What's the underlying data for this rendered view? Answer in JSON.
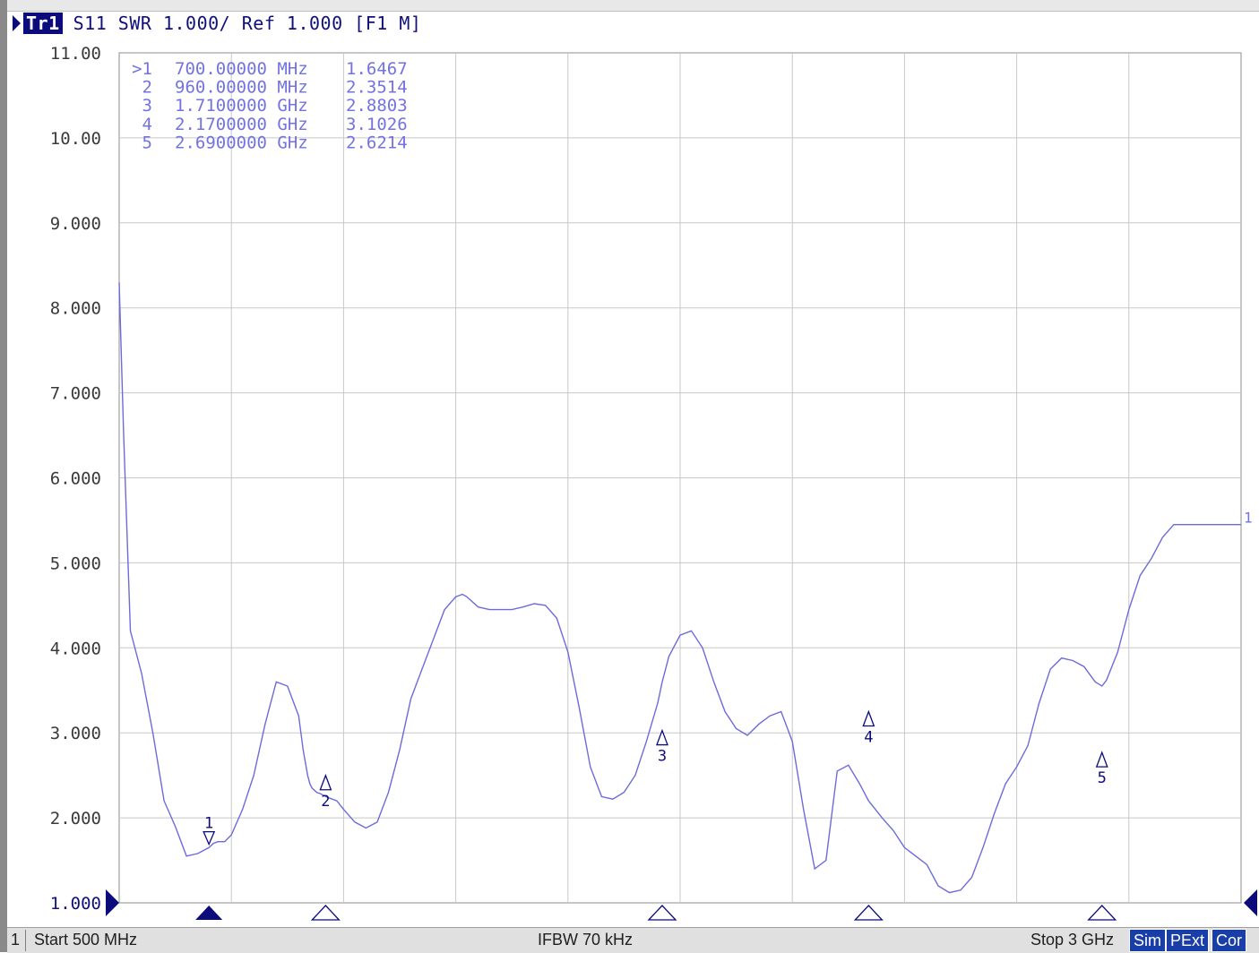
{
  "header": {
    "trace_badge": "Tr1",
    "measurement": "S11 SWR 1.000/ Ref 1.000 [F1 M]"
  },
  "marker_table": [
    {
      "id": ">1",
      "freq": "700.00000 MHz",
      "value": "1.6467"
    },
    {
      "id": "2",
      "freq": "960.00000 MHz",
      "value": "2.3514"
    },
    {
      "id": "3",
      "freq": "1.7100000 GHz",
      "value": "2.8803"
    },
    {
      "id": "4",
      "freq": "2.1700000 GHz",
      "value": "3.1026"
    },
    {
      "id": "5",
      "freq": "2.6900000 GHz",
      "value": "2.6214"
    }
  ],
  "status": {
    "channel": "1",
    "start": "Start 500 MHz",
    "ifbw": "IFBW 70 kHz",
    "stop": "Stop 3 GHz",
    "badges": [
      "Sim",
      "PExt",
      "Cor"
    ]
  },
  "colors": {
    "trace": "#6b6bdc",
    "grid": "#c8c8c8",
    "marker_active": "#0b0b7c",
    "axis_text": "#3a3a3a",
    "marker_text": "#7373e0"
  },
  "chart_data": {
    "type": "line",
    "xlabel": "",
    "ylabel": "",
    "x_unit": "GHz",
    "xlim": [
      0.5,
      3.0
    ],
    "ylim": [
      1.0,
      11.0
    ],
    "y_ticks": [
      "11.00",
      "10.00",
      "9.000",
      "8.000",
      "7.000",
      "6.000",
      "5.000",
      "4.000",
      "3.000",
      "2.000",
      "1.000"
    ],
    "grid": true,
    "trace_end_label": "1",
    "series": [
      {
        "x": [
          0.5,
          0.51,
          0.525,
          0.55,
          0.575,
          0.6,
          0.625,
          0.65,
          0.675,
          0.7,
          0.71,
          0.72,
          0.735,
          0.75,
          0.775,
          0.8,
          0.825,
          0.85,
          0.875,
          0.9,
          0.91,
          0.92,
          0.925,
          0.93,
          0.94,
          0.95,
          0.96,
          0.97,
          0.985,
          1.0,
          1.025,
          1.05,
          1.075,
          1.1,
          1.125,
          1.15,
          1.175,
          1.2,
          1.225,
          1.25,
          1.265,
          1.275,
          1.3,
          1.325,
          1.35,
          1.375,
          1.4,
          1.425,
          1.45,
          1.475,
          1.5,
          1.525,
          1.55,
          1.575,
          1.6,
          1.625,
          1.65,
          1.675,
          1.7,
          1.71,
          1.725,
          1.75,
          1.775,
          1.8,
          1.825,
          1.85,
          1.875,
          1.9,
          1.925,
          1.95,
          1.975,
          2.0,
          2.025,
          2.05,
          2.075,
          2.1,
          2.125,
          2.15,
          2.17,
          2.2,
          2.225,
          2.25,
          2.275,
          2.3,
          2.31,
          2.325,
          2.35,
          2.375,
          2.4,
          2.425,
          2.45,
          2.475,
          2.5,
          2.525,
          2.55,
          2.575,
          2.6,
          2.625,
          2.65,
          2.675,
          2.69,
          2.7,
          2.725,
          2.75,
          2.775,
          2.8,
          2.825,
          2.85,
          2.875,
          2.9,
          2.925,
          2.95,
          2.975,
          3.0
        ],
        "values": [
          8.3,
          6.5,
          4.2,
          3.7,
          3.0,
          2.2,
          1.9,
          1.55,
          1.58,
          1.65,
          1.7,
          1.72,
          1.72,
          1.8,
          2.1,
          2.5,
          3.1,
          3.6,
          3.55,
          3.2,
          2.8,
          2.5,
          2.4,
          2.35,
          2.3,
          2.28,
          2.25,
          2.23,
          2.2,
          2.1,
          1.95,
          1.88,
          1.95,
          2.3,
          2.8,
          3.4,
          3.75,
          4.1,
          4.45,
          4.6,
          4.63,
          4.6,
          4.48,
          4.45,
          4.45,
          4.45,
          4.48,
          4.52,
          4.5,
          4.35,
          3.95,
          3.3,
          2.6,
          2.25,
          2.22,
          2.3,
          2.5,
          2.9,
          3.35,
          3.6,
          3.9,
          4.15,
          4.2,
          4.0,
          3.6,
          3.25,
          3.05,
          2.97,
          3.1,
          3.2,
          3.25,
          2.9,
          2.1,
          1.4,
          1.5,
          2.55,
          2.62,
          2.4,
          2.2,
          2.0,
          1.85,
          1.65,
          1.55,
          1.45,
          1.35,
          1.2,
          1.12,
          1.15,
          1.3,
          1.65,
          2.05,
          2.4,
          2.6,
          2.85,
          3.35,
          3.75,
          3.88,
          3.85,
          3.78,
          3.6,
          3.55,
          3.62,
          3.95,
          4.45,
          4.85,
          5.05,
          5.3,
          5.45,
          5.45,
          5.45,
          5.45,
          5.45,
          5.45,
          5.45
        ]
      }
    ],
    "markers": [
      {
        "label": "1",
        "x": 0.7,
        "y": 1.6467,
        "active": true
      },
      {
        "label": "2",
        "x": 0.96,
        "y": 2.3514,
        "active": false
      },
      {
        "label": "3",
        "x": 1.71,
        "y": 2.8803,
        "active": false
      },
      {
        "label": "4",
        "x": 2.17,
        "y": 3.1026,
        "active": false
      },
      {
        "label": "5",
        "x": 2.69,
        "y": 2.6214,
        "active": false
      }
    ]
  }
}
